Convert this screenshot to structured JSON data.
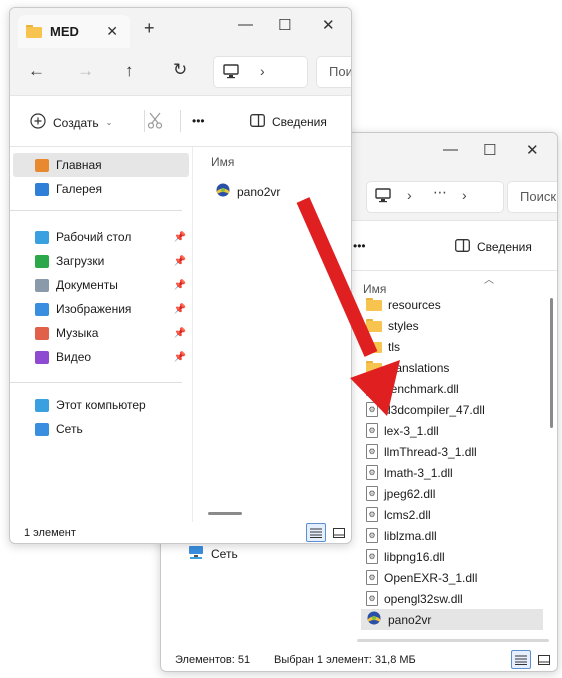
{
  "back_window": {
    "nav": {
      "search_placeholder": "Поиск"
    },
    "toolbar": {
      "more_label": "•••",
      "details_label": "Сведения"
    },
    "sidebar": {
      "network_label": "Сеть"
    },
    "files": {
      "header_name": "Имя",
      "items": [
        {
          "name": "resources",
          "type": "folder"
        },
        {
          "name": "styles",
          "type": "folder"
        },
        {
          "name": "tls",
          "type": "folder"
        },
        {
          "name": "translations",
          "type": "folder"
        },
        {
          "name": "benchmark.dll",
          "type": "dll"
        },
        {
          "name": "d3dcompiler_47.dll",
          "type": "dll"
        },
        {
          "name": "lex-3_1.dll",
          "type": "dll"
        },
        {
          "name": "llmThread-3_1.dll",
          "type": "dll"
        },
        {
          "name": "lmath-3_1.dll",
          "type": "dll"
        },
        {
          "name": "jpeg62.dll",
          "type": "dll"
        },
        {
          "name": "lcms2.dll",
          "type": "dll"
        },
        {
          "name": "liblzma.dll",
          "type": "dll"
        },
        {
          "name": "libpng16.dll",
          "type": "dll"
        },
        {
          "name": "OpenEXR-3_1.dll",
          "type": "dll"
        },
        {
          "name": "opengl32sw.dll",
          "type": "dll"
        },
        {
          "name": "pano2vr",
          "type": "app"
        }
      ]
    },
    "status": {
      "count": "Элементов: 51",
      "selection": "Выбран 1 элемент: 31,8 МБ"
    }
  },
  "front_window": {
    "tab": {
      "title": "MED"
    },
    "nav": {
      "search_placeholder": "Поиск"
    },
    "toolbar": {
      "create_label": "Создать",
      "more_label": "•••",
      "details_label": "Сведения"
    },
    "sidebar": {
      "group1": [
        {
          "label": "Главная",
          "icon": "home-icon",
          "color": "#e8882f"
        },
        {
          "label": "Галерея",
          "icon": "gallery-icon",
          "color": "#2f7fd8"
        }
      ],
      "group2": [
        {
          "label": "Рабочий стол",
          "icon": "desktop-icon",
          "color": "#3aa0e0"
        },
        {
          "label": "Загрузки",
          "icon": "download-icon",
          "color": "#2aa84a"
        },
        {
          "label": "Документы",
          "icon": "documents-icon",
          "color": "#8a9aab"
        },
        {
          "label": "Изображения",
          "icon": "pictures-icon",
          "color": "#3a8ee0"
        },
        {
          "label": "Музыка",
          "icon": "music-icon",
          "color": "#e0604a"
        },
        {
          "label": "Видео",
          "icon": "video-icon",
          "color": "#8e4ad0"
        }
      ],
      "group3": [
        {
          "label": "Этот компьютер",
          "icon": "computer-icon",
          "color": "#3aa0e0"
        },
        {
          "label": "Сеть",
          "icon": "network-icon",
          "color": "#3a8ee0"
        }
      ]
    },
    "files": {
      "header_name": "Имя",
      "items": [
        {
          "name": "pano2vr"
        }
      ]
    },
    "status": {
      "count": "1 элемент"
    }
  },
  "arrow": {
    "color": "#e02020"
  }
}
